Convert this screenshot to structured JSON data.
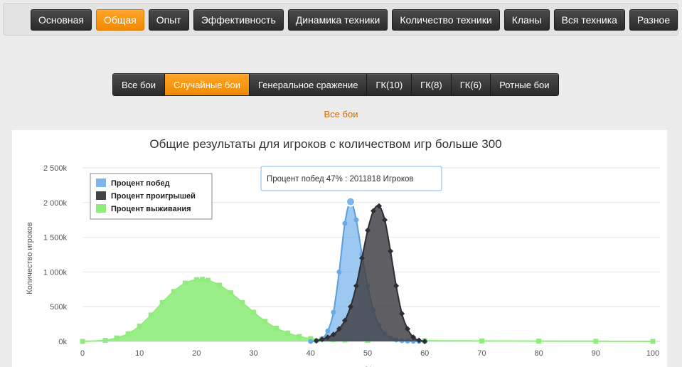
{
  "top_nav": [
    {
      "label": "Основная",
      "active": false
    },
    {
      "label": "Общая",
      "active": true
    },
    {
      "label": "Опыт",
      "active": false
    },
    {
      "label": "Эффективность",
      "active": false
    },
    {
      "label": "Динамика техники",
      "active": false
    },
    {
      "label": "Количество техники",
      "active": false
    },
    {
      "label": "Кланы",
      "active": false
    },
    {
      "label": "Вся техника",
      "active": false
    },
    {
      "label": "Разное",
      "active": false
    }
  ],
  "sub_nav": [
    {
      "label": "Все бои",
      "active": false
    },
    {
      "label": "Случайные бои",
      "active": true
    },
    {
      "label": "Генеральное сражение",
      "active": false
    },
    {
      "label": "ГК(10)",
      "active": false
    },
    {
      "label": "ГК(8)",
      "active": false
    },
    {
      "label": "ГК(6)",
      "active": false
    },
    {
      "label": "Ротные бои",
      "active": false
    }
  ],
  "subtitle": "Все бои",
  "tooltip": "Процент побед 47% : 2011818 Игроков",
  "colors": {
    "wins": "#7cb5ec",
    "losses": "#434348",
    "survival": "#90ed7d",
    "accent": "#f08a00"
  },
  "chart_data": {
    "type": "area",
    "title": "Общие результаты для игроков с количеством игр больше 300",
    "ylabel": "Количество игроков",
    "xlabel": "%",
    "xlim": [
      0,
      100
    ],
    "ylim": [
      0,
      2500000
    ],
    "x_ticks": [
      "0",
      "10",
      "20",
      "30",
      "40",
      "50",
      "60",
      "70",
      "80",
      "90",
      "100"
    ],
    "y_ticks": [
      "0k",
      "500k",
      "1 000k",
      "1 500k",
      "2 000k",
      "2 500k"
    ],
    "legend": {
      "position": "top-left"
    },
    "series": [
      {
        "name": "Процент побед",
        "color": "#7cb5ec",
        "x": [
          40,
          41,
          42,
          43,
          44,
          45,
          46,
          47,
          48,
          49,
          50,
          51,
          52,
          53,
          54,
          55,
          56,
          57,
          58,
          59,
          60
        ],
        "y": [
          0,
          8000,
          40000,
          150000,
          420000,
          1000000,
          1700000,
          2011818,
          1750000,
          1250000,
          800000,
          450000,
          230000,
          110000,
          50000,
          22000,
          10000,
          5000,
          2000,
          1000,
          0
        ]
      },
      {
        "name": "Процент проигрышей",
        "color": "#434348",
        "x": [
          41,
          42,
          43,
          44,
          45,
          46,
          47,
          48,
          49,
          50,
          51,
          52,
          53,
          54,
          55,
          56,
          57,
          58,
          59,
          60
        ],
        "y": [
          10000,
          30000,
          60000,
          100000,
          180000,
          300000,
          500000,
          800000,
          1200000,
          1600000,
          1880000,
          1950000,
          1750000,
          1300000,
          800000,
          400000,
          180000,
          60000,
          15000,
          0
        ]
      },
      {
        "name": "Процент выживания",
        "color": "#90ed7d",
        "x": [
          0,
          4,
          6,
          8,
          10,
          12,
          14,
          16,
          18,
          20,
          21,
          22,
          24,
          26,
          28,
          30,
          32,
          34,
          36,
          38,
          40,
          42,
          44,
          46,
          50,
          60,
          70,
          80,
          90,
          100
        ],
        "y": [
          0,
          15000,
          50000,
          110000,
          220000,
          380000,
          560000,
          720000,
          840000,
          890000,
          895000,
          880000,
          810000,
          700000,
          560000,
          420000,
          290000,
          190000,
          120000,
          70000,
          40000,
          30000,
          25000,
          20000,
          15000,
          10000,
          6000,
          4000,
          2000,
          0
        ]
      }
    ]
  }
}
